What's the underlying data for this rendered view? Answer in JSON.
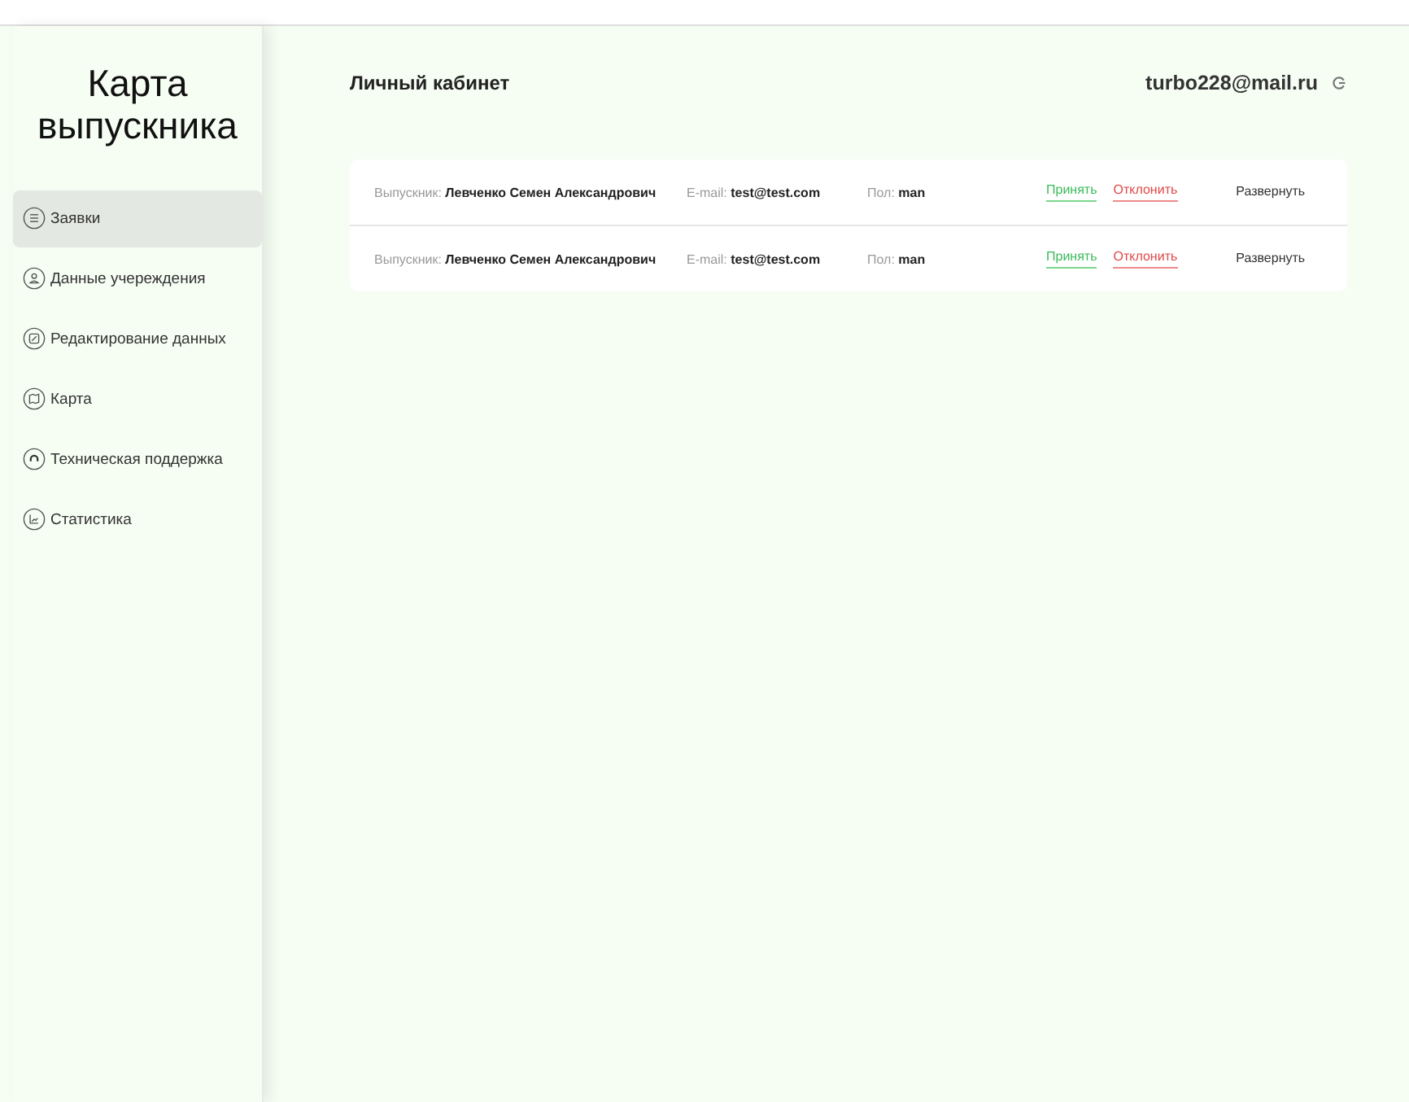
{
  "sidebar": {
    "title": "Карта выпускника",
    "items": [
      {
        "label": "Заявки",
        "selected": true
      },
      {
        "label": "Данные учереждения",
        "selected": false
      },
      {
        "label": "Редактирование данных",
        "selected": false
      },
      {
        "label": "Карта",
        "selected": false
      },
      {
        "label": "Техническая поддержка",
        "selected": false
      },
      {
        "label": "Статистика",
        "selected": false
      }
    ]
  },
  "header": {
    "title": "Личный кабинет",
    "user_email": "turbo228@mail.ru"
  },
  "requests": [
    {
      "graduate_label": "Выпускник:",
      "graduate": "Левченко Семен Александрович",
      "email_label": "E-mail:",
      "email": "test@test.com",
      "gender_label": "Пол:",
      "gender": "man",
      "accept": "Принять",
      "reject": "Отклонить",
      "expand": "Развернуть"
    },
    {
      "graduate_label": "Выпускник:",
      "graduate": "Левченко Семен Александрович",
      "email_label": "E-mail:",
      "email": "test@test.com",
      "gender_label": "Пол:",
      "gender": "man",
      "accept": "Принять",
      "reject": "Отклонить",
      "expand": "Развернуть"
    }
  ]
}
